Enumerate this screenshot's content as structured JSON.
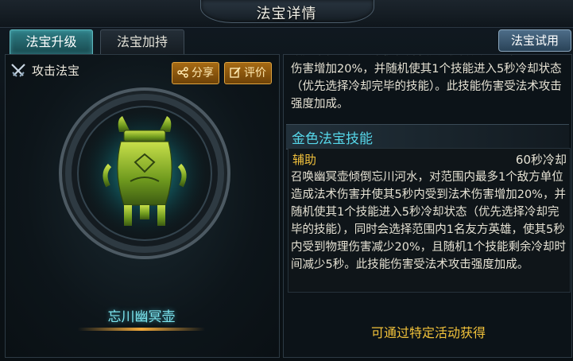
{
  "header": {
    "title": "法宝详情"
  },
  "tabs": [
    {
      "label": "法宝升级",
      "active": true
    },
    {
      "label": "法宝加持",
      "active": false
    }
  ],
  "trial_button": "法宝试用",
  "left_panel": {
    "type_icon": "crossed-swords-icon",
    "type_label": "攻击法宝",
    "share_label": "分享",
    "review_label": "评价",
    "treasure_name": "忘川幽冥壶"
  },
  "right_panel": {
    "cut_line": "敌方单位造成法术伤害并使其5秒内受到法术",
    "prev_lines": "伤害增加20%，并随机使其1个技能进入5秒冷却状态（优先选择冷却完毕的技能）。此技能伤害受法术攻击强度加成。",
    "section_title": "金色法宝技能",
    "skill_type": "辅助",
    "skill_cooldown": "60秒冷却",
    "skill_desc": "召唤幽冥壶倾倒忘川河水，对范围内最多1个敌方单位造成法术伤害并使其5秒内受到法术伤害增加20%，并随机使其1个技能进入5秒冷却状态（优先选择冷却完毕的技能），同时会选择范围内1名友方英雄，使其5秒内受到物理伤害减少20%，且随机1个技能剩余冷却时间减少5秒。此技能伤害受法术攻击强度加成。",
    "obtain_text": "可通过特定活动获得"
  },
  "colors": {
    "accent_cyan": "#56d7ea",
    "gold": "#f2c23a",
    "button_orange": "#a66a14"
  }
}
